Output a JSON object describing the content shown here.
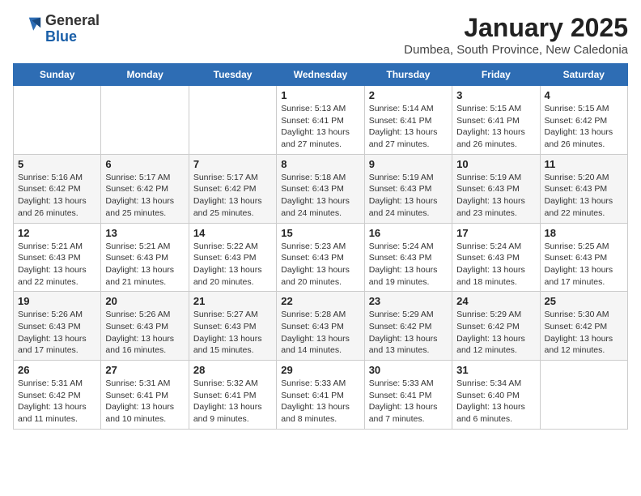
{
  "header": {
    "logo_general": "General",
    "logo_blue": "Blue",
    "month_year": "January 2025",
    "location": "Dumbea, South Province, New Caledonia"
  },
  "weekdays": [
    "Sunday",
    "Monday",
    "Tuesday",
    "Wednesday",
    "Thursday",
    "Friday",
    "Saturday"
  ],
  "weeks": [
    [
      {
        "day": "",
        "info": ""
      },
      {
        "day": "",
        "info": ""
      },
      {
        "day": "",
        "info": ""
      },
      {
        "day": "1",
        "info": "Sunrise: 5:13 AM\nSunset: 6:41 PM\nDaylight: 13 hours\nand 27 minutes."
      },
      {
        "day": "2",
        "info": "Sunrise: 5:14 AM\nSunset: 6:41 PM\nDaylight: 13 hours\nand 27 minutes."
      },
      {
        "day": "3",
        "info": "Sunrise: 5:15 AM\nSunset: 6:41 PM\nDaylight: 13 hours\nand 26 minutes."
      },
      {
        "day": "4",
        "info": "Sunrise: 5:15 AM\nSunset: 6:42 PM\nDaylight: 13 hours\nand 26 minutes."
      }
    ],
    [
      {
        "day": "5",
        "info": "Sunrise: 5:16 AM\nSunset: 6:42 PM\nDaylight: 13 hours\nand 26 minutes."
      },
      {
        "day": "6",
        "info": "Sunrise: 5:17 AM\nSunset: 6:42 PM\nDaylight: 13 hours\nand 25 minutes."
      },
      {
        "day": "7",
        "info": "Sunrise: 5:17 AM\nSunset: 6:42 PM\nDaylight: 13 hours\nand 25 minutes."
      },
      {
        "day": "8",
        "info": "Sunrise: 5:18 AM\nSunset: 6:43 PM\nDaylight: 13 hours\nand 24 minutes."
      },
      {
        "day": "9",
        "info": "Sunrise: 5:19 AM\nSunset: 6:43 PM\nDaylight: 13 hours\nand 24 minutes."
      },
      {
        "day": "10",
        "info": "Sunrise: 5:19 AM\nSunset: 6:43 PM\nDaylight: 13 hours\nand 23 minutes."
      },
      {
        "day": "11",
        "info": "Sunrise: 5:20 AM\nSunset: 6:43 PM\nDaylight: 13 hours\nand 22 minutes."
      }
    ],
    [
      {
        "day": "12",
        "info": "Sunrise: 5:21 AM\nSunset: 6:43 PM\nDaylight: 13 hours\nand 22 minutes."
      },
      {
        "day": "13",
        "info": "Sunrise: 5:21 AM\nSunset: 6:43 PM\nDaylight: 13 hours\nand 21 minutes."
      },
      {
        "day": "14",
        "info": "Sunrise: 5:22 AM\nSunset: 6:43 PM\nDaylight: 13 hours\nand 20 minutes."
      },
      {
        "day": "15",
        "info": "Sunrise: 5:23 AM\nSunset: 6:43 PM\nDaylight: 13 hours\nand 20 minutes."
      },
      {
        "day": "16",
        "info": "Sunrise: 5:24 AM\nSunset: 6:43 PM\nDaylight: 13 hours\nand 19 minutes."
      },
      {
        "day": "17",
        "info": "Sunrise: 5:24 AM\nSunset: 6:43 PM\nDaylight: 13 hours\nand 18 minutes."
      },
      {
        "day": "18",
        "info": "Sunrise: 5:25 AM\nSunset: 6:43 PM\nDaylight: 13 hours\nand 17 minutes."
      }
    ],
    [
      {
        "day": "19",
        "info": "Sunrise: 5:26 AM\nSunset: 6:43 PM\nDaylight: 13 hours\nand 17 minutes."
      },
      {
        "day": "20",
        "info": "Sunrise: 5:26 AM\nSunset: 6:43 PM\nDaylight: 13 hours\nand 16 minutes."
      },
      {
        "day": "21",
        "info": "Sunrise: 5:27 AM\nSunset: 6:43 PM\nDaylight: 13 hours\nand 15 minutes."
      },
      {
        "day": "22",
        "info": "Sunrise: 5:28 AM\nSunset: 6:43 PM\nDaylight: 13 hours\nand 14 minutes."
      },
      {
        "day": "23",
        "info": "Sunrise: 5:29 AM\nSunset: 6:42 PM\nDaylight: 13 hours\nand 13 minutes."
      },
      {
        "day": "24",
        "info": "Sunrise: 5:29 AM\nSunset: 6:42 PM\nDaylight: 13 hours\nand 12 minutes."
      },
      {
        "day": "25",
        "info": "Sunrise: 5:30 AM\nSunset: 6:42 PM\nDaylight: 13 hours\nand 12 minutes."
      }
    ],
    [
      {
        "day": "26",
        "info": "Sunrise: 5:31 AM\nSunset: 6:42 PM\nDaylight: 13 hours\nand 11 minutes."
      },
      {
        "day": "27",
        "info": "Sunrise: 5:31 AM\nSunset: 6:41 PM\nDaylight: 13 hours\nand 10 minutes."
      },
      {
        "day": "28",
        "info": "Sunrise: 5:32 AM\nSunset: 6:41 PM\nDaylight: 13 hours\nand 9 minutes."
      },
      {
        "day": "29",
        "info": "Sunrise: 5:33 AM\nSunset: 6:41 PM\nDaylight: 13 hours\nand 8 minutes."
      },
      {
        "day": "30",
        "info": "Sunrise: 5:33 AM\nSunset: 6:41 PM\nDaylight: 13 hours\nand 7 minutes."
      },
      {
        "day": "31",
        "info": "Sunrise: 5:34 AM\nSunset: 6:40 PM\nDaylight: 13 hours\nand 6 minutes."
      },
      {
        "day": "",
        "info": ""
      }
    ]
  ]
}
